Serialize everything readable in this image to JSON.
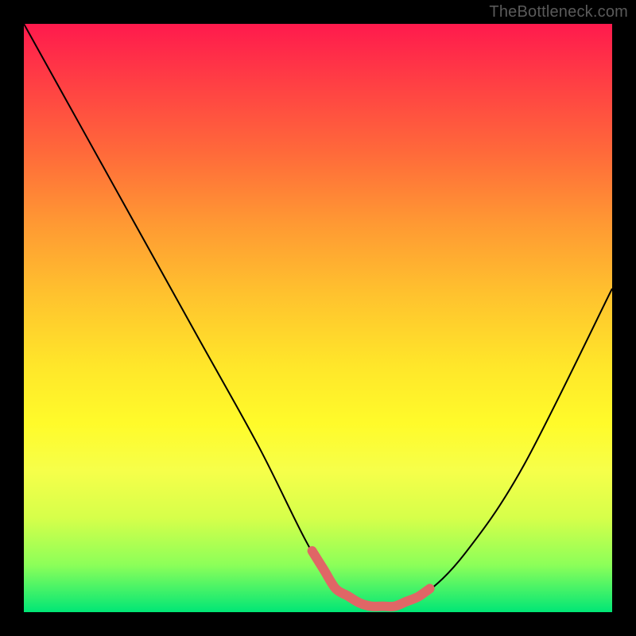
{
  "watermark": "TheBottleneck.com",
  "colors": {
    "curve_stroke": "#000000",
    "highlight_stroke": "#e06666",
    "gradient_top": "#ff1a4d",
    "gradient_bottom": "#00e676"
  },
  "chart_data": {
    "type": "line",
    "title": "",
    "xlabel": "",
    "ylabel": "",
    "xlim": [
      0,
      100
    ],
    "ylim": [
      0,
      100
    ],
    "grid": false,
    "series": [
      {
        "name": "bottleneck-curve",
        "x": [
          0,
          10,
          20,
          30,
          40,
          48,
          53,
          58,
          63,
          68,
          75,
          85,
          100
        ],
        "y": [
          100,
          82,
          64,
          46,
          28,
          12,
          4,
          1,
          1,
          3,
          10,
          25,
          55
        ]
      }
    ],
    "annotations": [
      {
        "name": "optimal-range-highlight",
        "x_range": [
          49,
          69
        ],
        "style": "thick-salmon"
      }
    ]
  }
}
